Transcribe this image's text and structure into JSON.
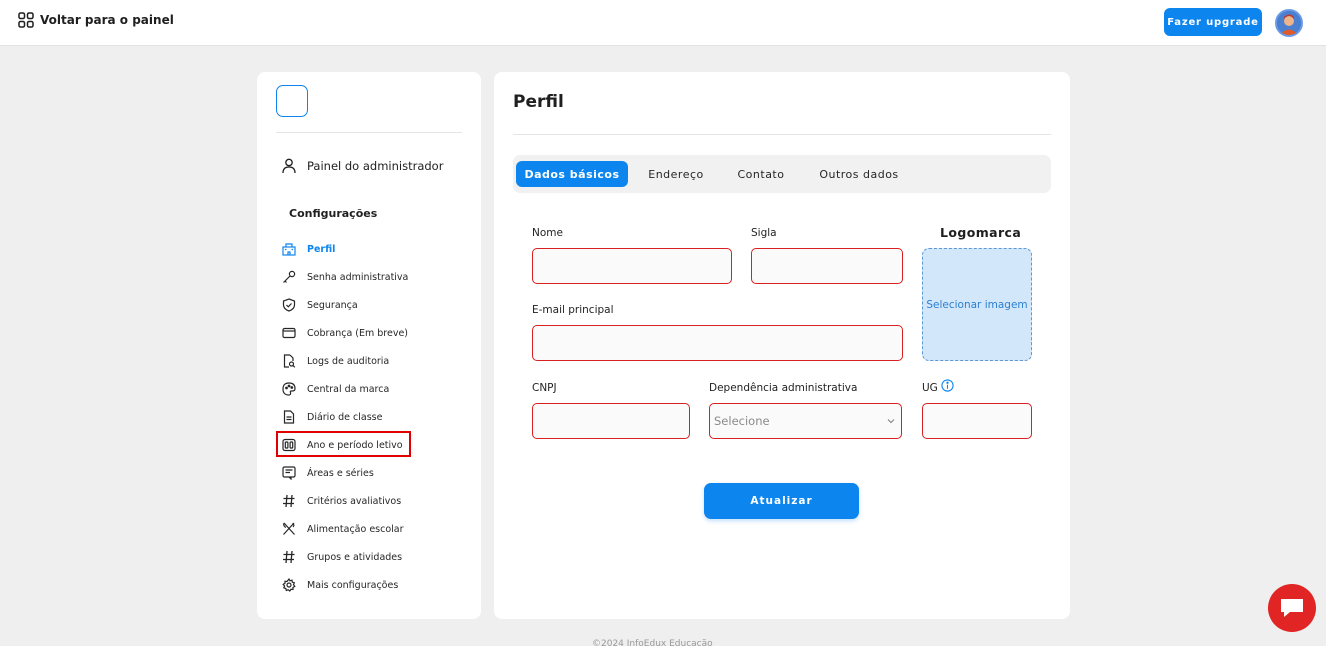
{
  "topbar": {
    "back_label": "Voltar para o painel",
    "upgrade_label": "Fazer upgrade",
    "avatar_icon": "user-avatar-icon"
  },
  "sidebar": {
    "admin_label": "Painel do administrador",
    "config_title": "Configurações",
    "items": [
      {
        "label": "Perfil",
        "icon": "building-icon",
        "active": true
      },
      {
        "label": "Senha administrativa",
        "icon": "key-icon"
      },
      {
        "label": "Segurança",
        "icon": "shield-icon"
      },
      {
        "label": "Cobrança (Em breve)",
        "icon": "credit-card-icon"
      },
      {
        "label": "Logs de auditoria",
        "icon": "file-search-icon"
      },
      {
        "label": "Central da marca",
        "icon": "palette-icon"
      },
      {
        "label": "Diário de classe",
        "icon": "document-icon"
      },
      {
        "label": "Ano e período letivo",
        "icon": "calendar-columns-icon",
        "highlighted": true
      },
      {
        "label": "Áreas e séries",
        "icon": "list-box-icon"
      },
      {
        "label": "Critérios avaliativos",
        "icon": "hash-icon"
      },
      {
        "label": "Alimentação escolar",
        "icon": "utensils-icon"
      },
      {
        "label": "Grupos e atividades",
        "icon": "hash-icon"
      },
      {
        "label": "Mais configurações",
        "icon": "gear-icon"
      }
    ]
  },
  "main": {
    "title": "Perfil",
    "tabs": [
      {
        "label": "Dados básicos",
        "active": true
      },
      {
        "label": "Endereço"
      },
      {
        "label": "Contato"
      },
      {
        "label": "Outros dados"
      }
    ],
    "form": {
      "nome_label": "Nome",
      "nome_value": "",
      "sigla_label": "Sigla",
      "sigla_value": "",
      "email_label": "E-mail principal",
      "email_value": "",
      "cnpj_label": "CNPJ",
      "cnpj_value": "",
      "dependencia_label": "Dependência administrativa",
      "dependencia_selected": "Selecione",
      "ug_label": "UG",
      "ug_value": "",
      "logo_label": "Logomarca",
      "logo_button": "Selecionar imagem"
    },
    "submit_label": "Atualizar"
  },
  "colors": {
    "accent": "#0d85ee",
    "error_border": "#d92020",
    "chat": "#e12424",
    "highlight": "#e00000"
  }
}
